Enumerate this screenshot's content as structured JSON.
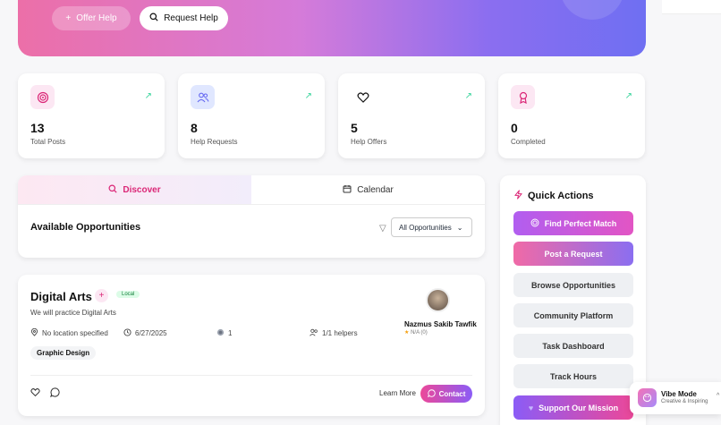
{
  "hero": {
    "offer_help_label": "Offer Help",
    "request_help_label": "Request Help"
  },
  "stats": [
    {
      "value": "13",
      "label": "Total Posts",
      "icon": "target-icon",
      "color": "#db2777"
    },
    {
      "value": "8",
      "label": "Help Requests",
      "icon": "users-icon",
      "color": "#6366f1"
    },
    {
      "value": "5",
      "label": "Help Offers",
      "icon": "heart-icon",
      "color": "#111111"
    },
    {
      "value": "0",
      "label": "Completed",
      "icon": "award-icon",
      "color": "#db2777"
    }
  ],
  "discover": {
    "tabs": [
      {
        "label": "Discover",
        "icon": "search-icon",
        "active": true
      },
      {
        "label": "Calendar",
        "icon": "calendar-icon",
        "active": false
      }
    ],
    "heading": "Available Opportunities",
    "filter_value": "All Opportunities"
  },
  "opportunity": {
    "title": "Digital Arts",
    "badge": "Local",
    "description": "We will practice Digital Arts",
    "location": "No location specified",
    "date": "6/27/2025",
    "count": "1",
    "helpers": "1/1 helpers",
    "tag": "Graphic Design",
    "owner_name": "Nazmus Sakib Tawfik",
    "owner_rating": "N/A (0)",
    "learn_more": "Learn More",
    "contact": "Contact"
  },
  "quick_actions": {
    "title": "Quick Actions",
    "buttons": [
      {
        "label": "Find Perfect Match",
        "style": "grad1"
      },
      {
        "label": "Post a Request",
        "style": "grad2"
      },
      {
        "label": "Browse Opportunities",
        "style": "plain"
      },
      {
        "label": "Community Platform",
        "style": "plain"
      },
      {
        "label": "Task Dashboard",
        "style": "plain"
      },
      {
        "label": "Track Hours",
        "style": "plain"
      },
      {
        "label": "Support Our Mission",
        "style": "grad3"
      }
    ]
  },
  "vibe": {
    "title": "Vibe Mode",
    "subtitle": "Creative & Inspiring"
  },
  "colors": {
    "accent_pink": "#db2777",
    "accent_purple": "#8b5cf6",
    "trend_green": "#34d399"
  }
}
